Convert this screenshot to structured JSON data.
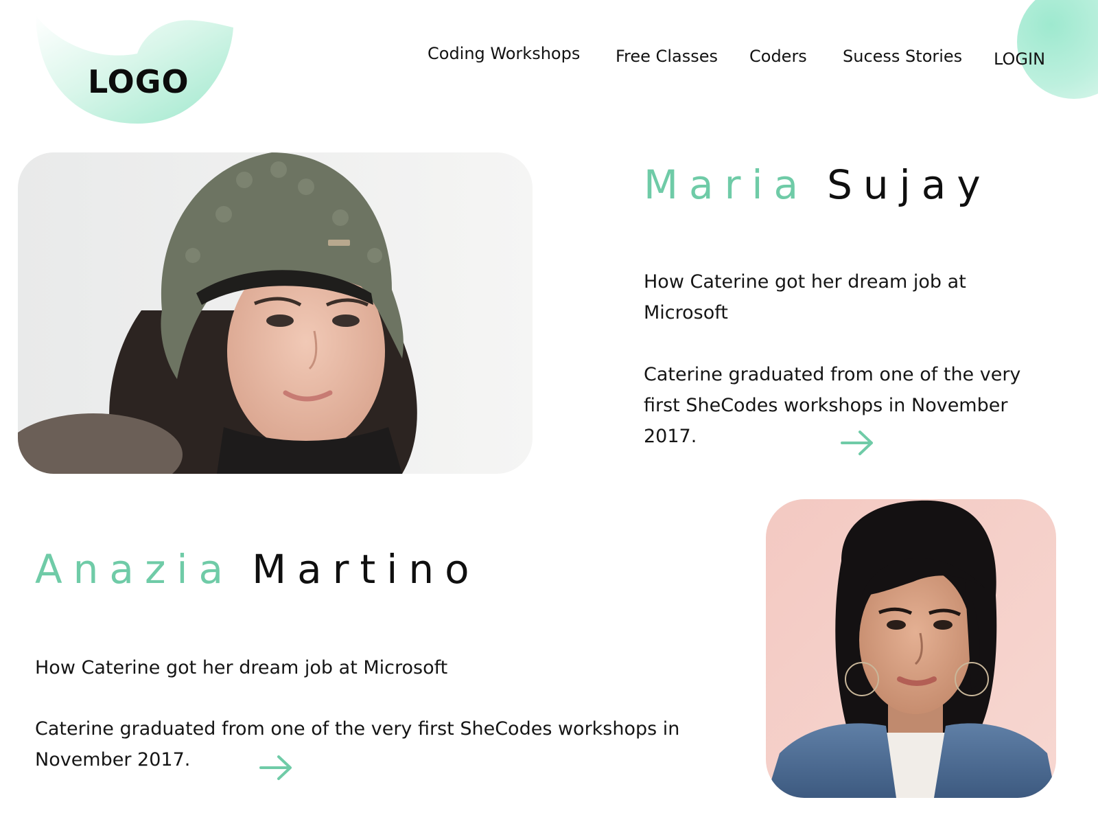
{
  "header": {
    "logo_text": "LOGO",
    "nav": [
      {
        "label": "Coding Workshops"
      },
      {
        "label": "Free Classes"
      },
      {
        "label": "Coders"
      },
      {
        "label": "Sucess Stories"
      },
      {
        "label": "LOGIN"
      }
    ]
  },
  "stories": [
    {
      "first_name": "Maria",
      "last_name": "Sujay",
      "headline": "How Caterine got her dream job at Microsoft",
      "body": "Caterine graduated from one of the very first SheCodes workshops in November 2017.",
      "arrow_icon": "arrow-right-icon"
    },
    {
      "first_name": "Anazia",
      "last_name": "Martino",
      "headline": "How Caterine got her dream job at Microsoft",
      "body": "Caterine graduated from one of the very first SheCodes workshops in November 2017.",
      "arrow_icon": "arrow-right-icon"
    }
  ],
  "colors": {
    "accent": "#6fcba7",
    "accent_light": "#bdf0de",
    "text": "#111111",
    "background": "#ffffff"
  }
}
